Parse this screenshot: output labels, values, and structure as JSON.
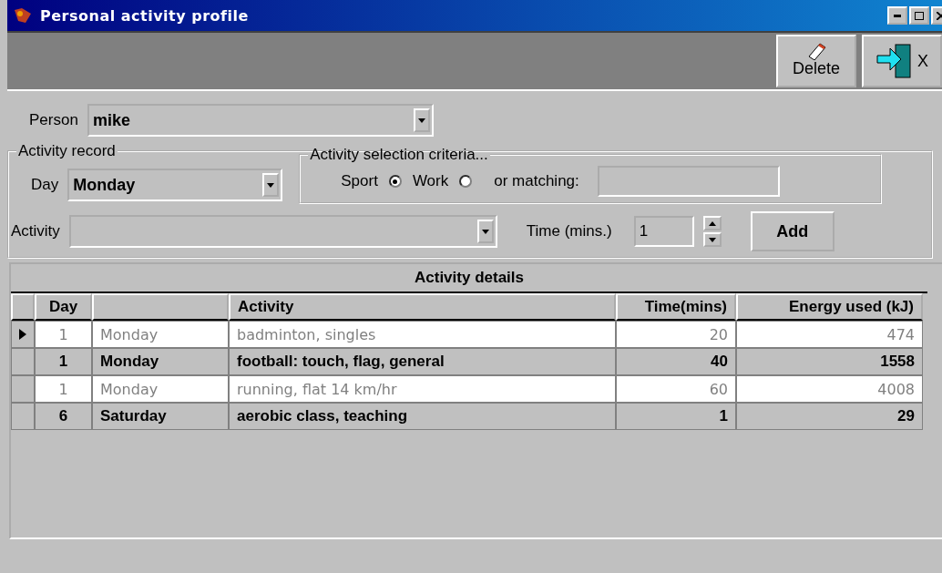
{
  "window": {
    "title": "Personal activity profile"
  },
  "toolbar": {
    "buttons": [
      {
        "label": "Delete",
        "kind": "delete"
      },
      {
        "label": "X",
        "kind": "exit"
      }
    ]
  },
  "person": {
    "label": "Person",
    "value": "mike"
  },
  "activity_record": {
    "title": "Activity record",
    "day_label": "Day",
    "day_value": "Monday",
    "criteria": {
      "title": "Activity selection criteria...",
      "options": [
        {
          "label": "Sport",
          "selected": true
        },
        {
          "label": "Work",
          "selected": false
        }
      ],
      "matching_label": "or matching:"
    },
    "activity_label": "Activity",
    "time_label": "Time (mins.)",
    "time_value": "1",
    "add_button": "Add"
  },
  "table": {
    "title": "Activity details",
    "columns": [
      "Day",
      "",
      "Activity",
      "Time(mins)",
      "Energy used (kJ)"
    ],
    "rows": [
      {
        "cells": [
          "1",
          "Monday",
          "badminton, singles",
          "20",
          "474"
        ],
        "kind": "light",
        "selected": true
      },
      {
        "cells": [
          "1",
          "Monday",
          "football: touch, flag, general",
          "40",
          "1558"
        ],
        "kind": "dark",
        "selected": false
      },
      {
        "cells": [
          "1",
          "Monday",
          "running, flat 14 km/hr",
          "60",
          "4008"
        ],
        "kind": "light",
        "selected": false
      },
      {
        "cells": [
          "6",
          "Saturday",
          "aerobic class, teaching",
          "1",
          "29"
        ],
        "kind": "dark",
        "selected": false
      }
    ]
  }
}
